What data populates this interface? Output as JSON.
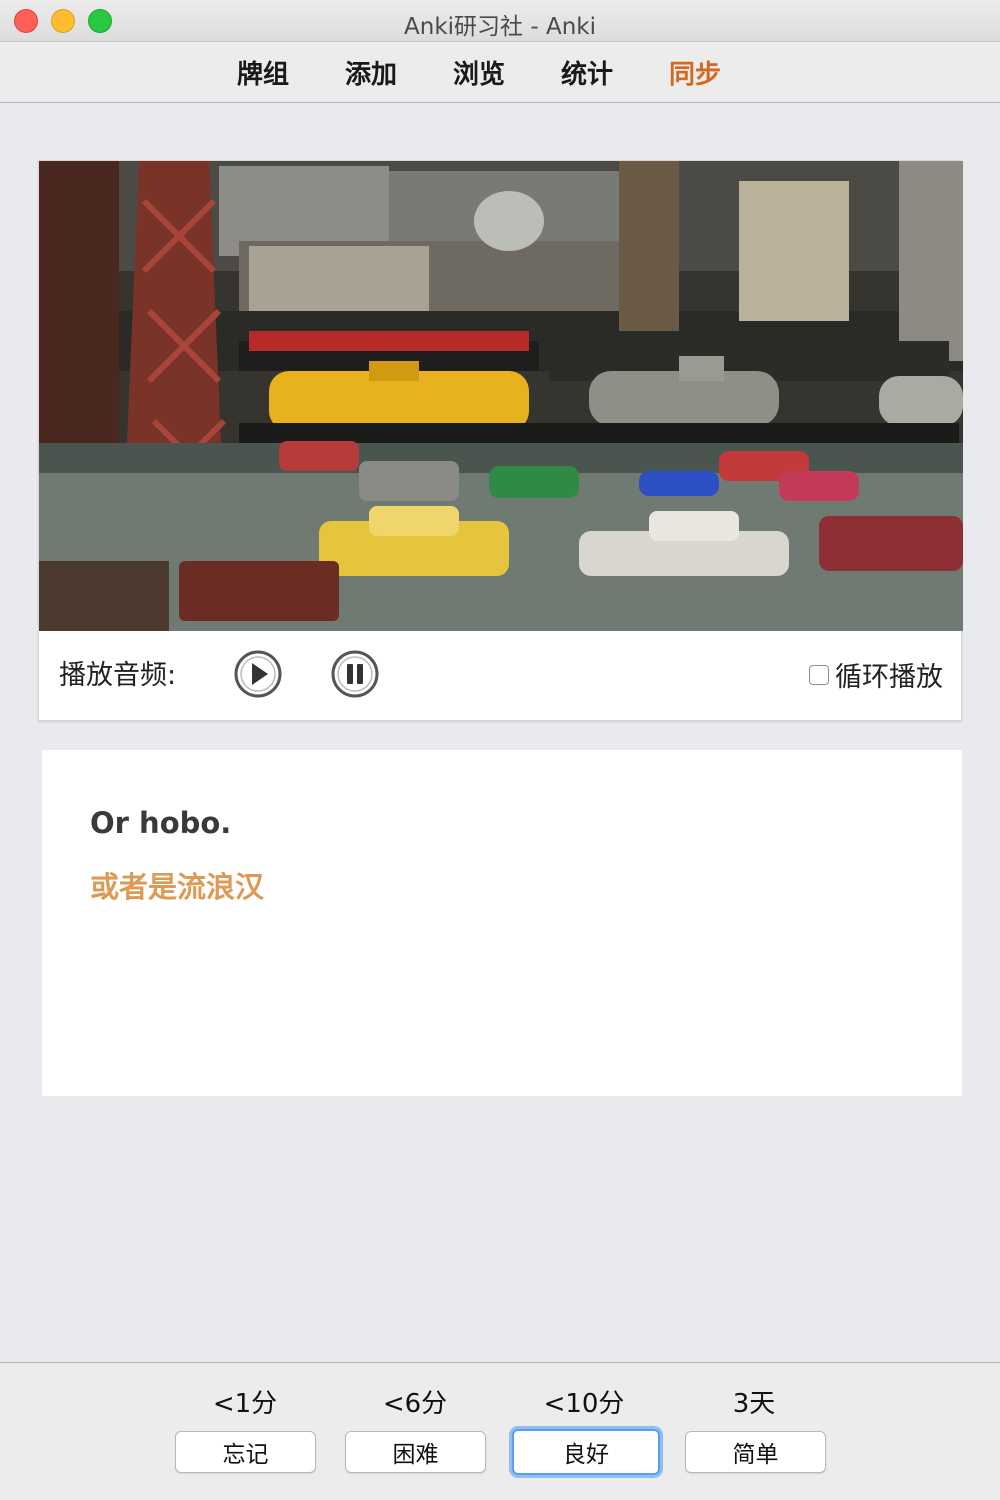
{
  "window": {
    "title": "Anki研习社 - Anki"
  },
  "toolbar": {
    "decks": "牌组",
    "add": "添加",
    "browse": "浏览",
    "stats": "统计",
    "sync": "同步",
    "sync_color": "#d2691e"
  },
  "media": {
    "video_description": "toy trains and toy cars",
    "audio_label": "播放音频:",
    "play_icon": "play-circle-icon",
    "pause_icon": "pause-circle-icon",
    "loop_label": "循环播放",
    "loop_checked": false
  },
  "card": {
    "sentence": "Or hobo.",
    "translation": "或者是流浪汉",
    "translation_color": "#dd9a55"
  },
  "answers": [
    {
      "interval": "<1分",
      "label": "忘记"
    },
    {
      "interval": "<6分",
      "label": "困难"
    },
    {
      "interval": "<10分",
      "label": "良好",
      "focused": true
    },
    {
      "interval": "3天",
      "label": "简单"
    }
  ]
}
